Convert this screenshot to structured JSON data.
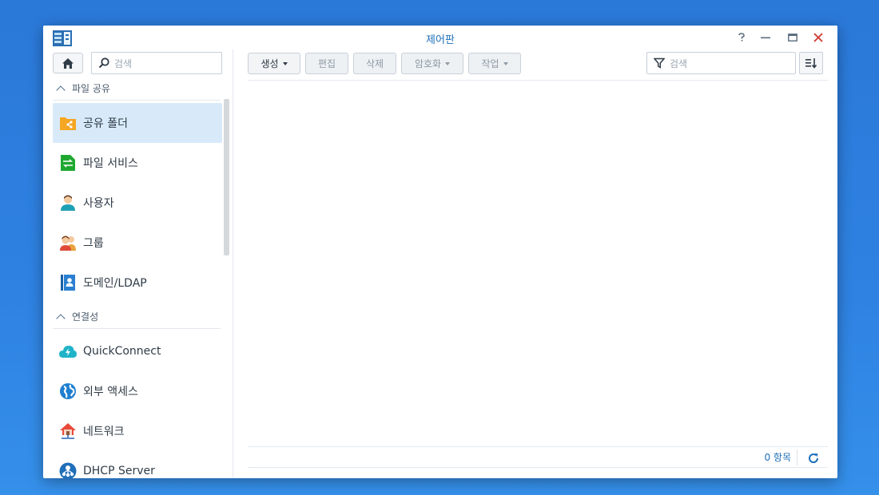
{
  "window": {
    "title": "제어판",
    "controls": [
      "help-icon",
      "minimize-icon",
      "maximize-icon",
      "close-icon"
    ]
  },
  "sidebar": {
    "search_placeholder": "검색",
    "sections": [
      {
        "label": "파일 공유",
        "items": [
          {
            "label": "공유 폴더",
            "icon": "shared-folder-icon",
            "active": true
          },
          {
            "label": "파일 서비스",
            "icon": "file-services-icon"
          },
          {
            "label": "사용자",
            "icon": "user-icon"
          },
          {
            "label": "그룹",
            "icon": "group-icon"
          },
          {
            "label": "도메인/LDAP",
            "icon": "domain-ldap-icon"
          }
        ]
      },
      {
        "label": "연결성",
        "items": [
          {
            "label": "QuickConnect",
            "icon": "quickconnect-icon"
          },
          {
            "label": "외부 액세스",
            "icon": "external-access-icon"
          },
          {
            "label": "네트워크",
            "icon": "network-icon"
          },
          {
            "label": "DHCP Server",
            "icon": "dhcp-server-icon"
          }
        ]
      }
    ]
  },
  "toolbar": {
    "create": "생성",
    "edit": "편집",
    "delete": "삭제",
    "encryption": "암호화",
    "action": "작업",
    "search_placeholder": "검색"
  },
  "footer": {
    "count": "0 항목"
  },
  "colors": {
    "accent": "#1f6fb9",
    "active_item_bg": "#d8eaf9",
    "close": "#d0382f",
    "desktop": "#2f82e2"
  }
}
